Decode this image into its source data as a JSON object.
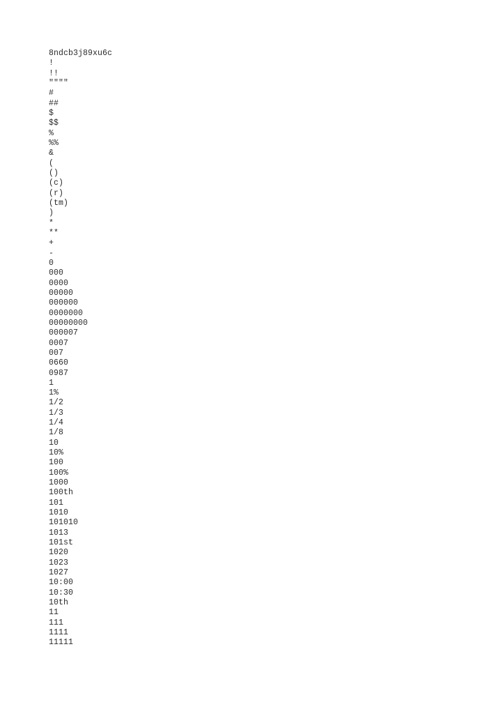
{
  "document": {
    "title": "8ndcb3j89xu6c",
    "background_color": "#ffffff",
    "text_color": "#2b2b2b",
    "lines": [
      "!",
      "!!",
      "\"\"\"\"",
      "#",
      "##",
      "$",
      "$$",
      "%",
      "%%",
      "&",
      "(",
      "()",
      "(c)",
      "(r)",
      "(tm)",
      ")",
      "*",
      "**",
      "+",
      "-",
      "0",
      "000",
      "0000",
      "00000",
      "000000",
      "0000000",
      "00000000",
      "000007",
      "0007",
      "007",
      "0660",
      "0987",
      "1",
      "1%",
      "1/2",
      "1/3",
      "1/4",
      "1/8",
      "10",
      "10%",
      "100",
      "100%",
      "1000",
      "100th",
      "101",
      "1010",
      "101010",
      "1013",
      "101st",
      "1020",
      "1023",
      "1027",
      "10:00",
      "10:30",
      "10th",
      "11",
      "111",
      "1111",
      "11111"
    ]
  }
}
